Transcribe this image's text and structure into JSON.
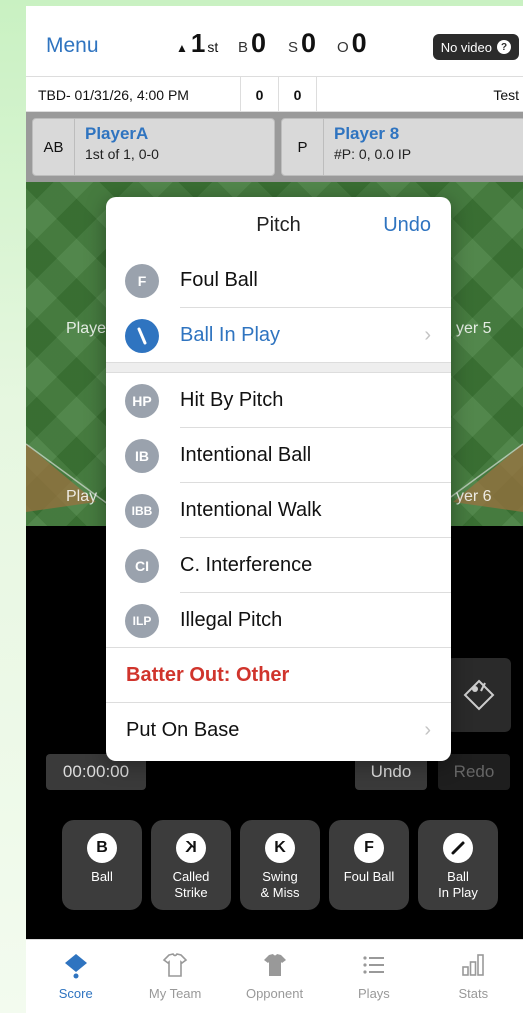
{
  "header": {
    "menu_label": "Menu",
    "inning_number": "1",
    "inning_suffix": "st",
    "balls_label": "B",
    "balls": "0",
    "strikes_label": "S",
    "strikes": "0",
    "outs_label": "O",
    "outs": "0",
    "no_video_label": "No video"
  },
  "game_info": {
    "title": "TBD- 01/31/26, 4:00 PM",
    "score_home": "0",
    "score_away": "0",
    "opponent": "Test"
  },
  "batter": {
    "tag": "AB",
    "name": "PlayerA",
    "detail": "1st of 1, 0-0"
  },
  "pitcher": {
    "tag": "P",
    "name": "Player 8",
    "detail": "#P: 0, 0.0 IP"
  },
  "field_labels": [
    "Playe",
    "yer 5",
    "Play",
    "yer 6"
  ],
  "pitch_menu": {
    "title": "Pitch",
    "undo_label": "Undo",
    "items": [
      {
        "badge": "F",
        "label": "Foul Ball"
      },
      {
        "badge": "/",
        "label": "Ball In Play"
      },
      {
        "badge": "HP",
        "label": "Hit By Pitch"
      },
      {
        "badge": "IB",
        "label": "Intentional Ball"
      },
      {
        "badge": "IBB",
        "label": "Intentional Walk"
      },
      {
        "badge": "CI",
        "label": "C. Interference"
      },
      {
        "badge": "ILP",
        "label": "Illegal Pitch"
      }
    ],
    "batter_out_label": "Batter Out: Other",
    "put_on_base_label": "Put On Base"
  },
  "controls": {
    "timer": "00:00:00",
    "undo": "Undo",
    "redo": "Redo"
  },
  "actions": [
    {
      "glyph": "B",
      "label": "Ball"
    },
    {
      "glyph": "K",
      "label": "Called\nStrike"
    },
    {
      "glyph": "K",
      "label": "Swing\n& Miss"
    },
    {
      "glyph": "F",
      "label": "Foul Ball"
    },
    {
      "glyph": "",
      "label": "Ball\nIn Play"
    }
  ],
  "tabs": [
    "Score",
    "My Team",
    "Opponent",
    "Plays",
    "Stats"
  ],
  "colors": {
    "accent": "#2f74c0",
    "danger": "#d0342c",
    "field": "#3f7a38"
  }
}
